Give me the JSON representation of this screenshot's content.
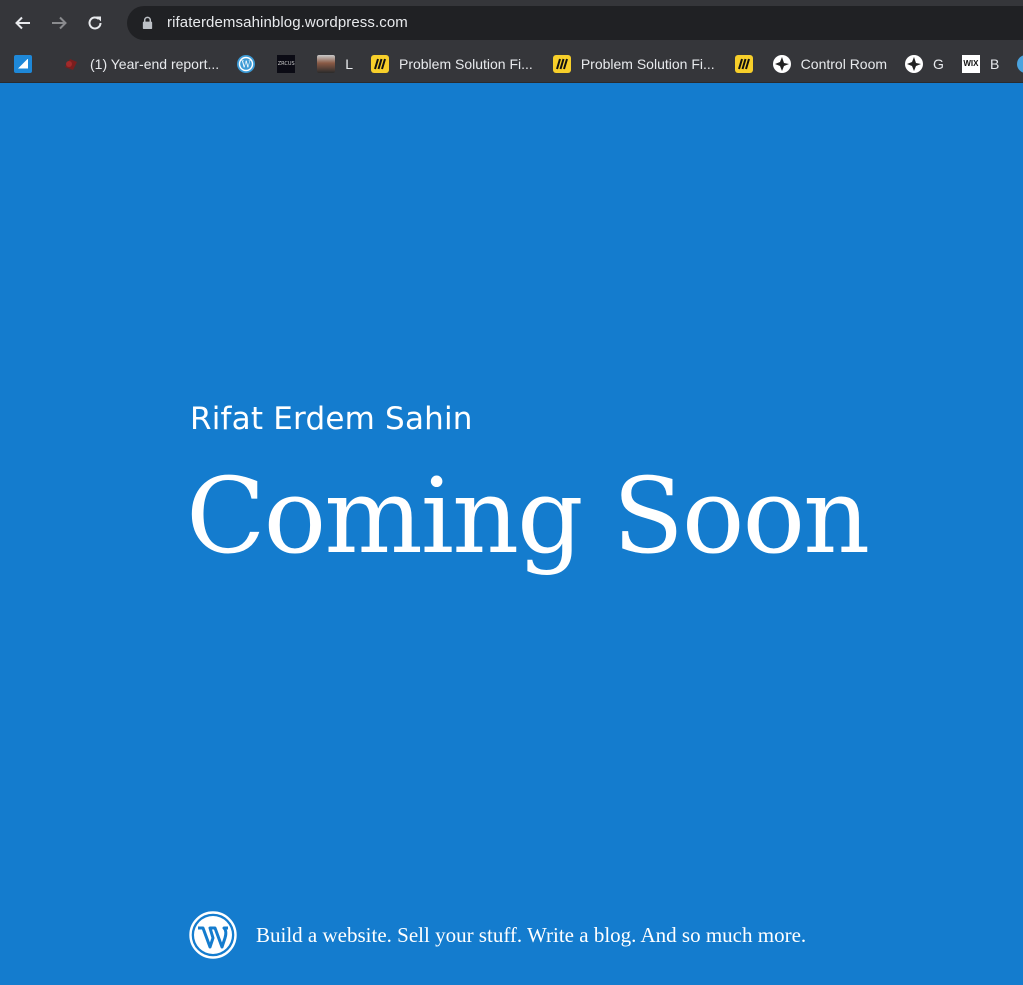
{
  "browser": {
    "url": "rifaterdemsahinblog.wordpress.com",
    "bookmarks": [
      {
        "label": "",
        "icon": "blue-square-icon"
      },
      {
        "label": "(1) Year-end report...",
        "icon": "red-icon"
      },
      {
        "label": "",
        "icon": "wordpress-icon"
      },
      {
        "label": "",
        "icon": "dark-app-icon",
        "icon_text": "ZRCUS"
      },
      {
        "label": "L",
        "icon": "profile-photo-icon"
      },
      {
        "label": "Problem Solution Fi...",
        "icon": "miro-icon"
      },
      {
        "label": "Problem Solution Fi...",
        "icon": "miro-icon"
      },
      {
        "label": "",
        "icon": "miro-icon"
      },
      {
        "label": "Control Room",
        "icon": "pinwheel-icon"
      },
      {
        "label": "G",
        "icon": "pinwheel-icon"
      },
      {
        "label": "B",
        "icon": "wix-icon",
        "icon_text": "WIX"
      },
      {
        "label": "",
        "icon": "globe-icon"
      }
    ]
  },
  "page": {
    "site_name": "Rifat Erdem Sahin",
    "headline": "Coming Soon",
    "tagline": "Build a website. Sell your stuff. Write a blog. And so much more.",
    "background_color": "#147cce",
    "text_color": "#ffffff"
  }
}
